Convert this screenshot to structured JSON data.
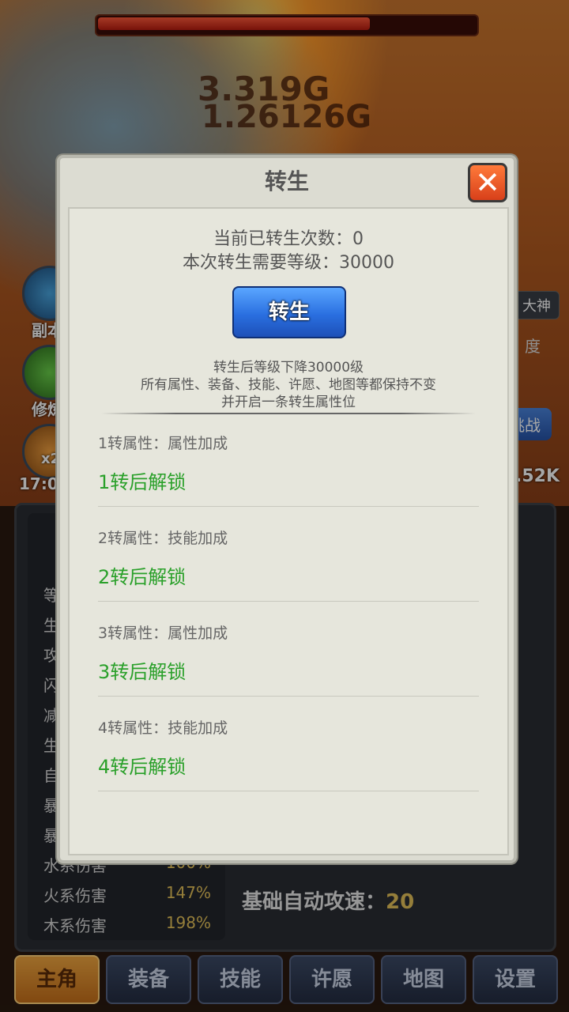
{
  "background": {
    "boss_hp_fraction": 0.72,
    "damage_numbers": [
      "3.319G",
      "1.26126G"
    ],
    "side_labels": [
      "副本",
      "修炼",
      "x2"
    ],
    "right_tag": "大神",
    "right_hint": "度",
    "challenge_label": "挑战",
    "time": "17:09",
    "power": "6.52K"
  },
  "stats": {
    "rows": [
      {
        "label": "等",
        "value": ""
      },
      {
        "label": "生",
        "value": ""
      },
      {
        "label": "攻",
        "value": ""
      },
      {
        "label": "闪",
        "value": ""
      },
      {
        "label": "减",
        "value": ""
      },
      {
        "label": "生",
        "value": ""
      },
      {
        "label": "自",
        "value": ""
      },
      {
        "label": "暴",
        "value": ""
      },
      {
        "label": "暴",
        "value": ""
      },
      {
        "label": "水系伤害",
        "value": "100%"
      },
      {
        "label": "火系伤害",
        "value": "147%"
      },
      {
        "label": "木系伤害",
        "value": "198%"
      }
    ],
    "auto_speed_label": "基础自动攻速：",
    "auto_speed_value": "20"
  },
  "tabs": [
    {
      "label": "主角",
      "active": true
    },
    {
      "label": "装备",
      "active": false
    },
    {
      "label": "技能",
      "active": false
    },
    {
      "label": "许愿",
      "active": false
    },
    {
      "label": "地图",
      "active": false
    },
    {
      "label": "设置",
      "active": false
    }
  ],
  "dialog": {
    "title": "转生",
    "close_icon": "close-x",
    "rebirth_count": "当前已转生次数：0",
    "required_level": "本次转生需要等级：30000",
    "rebirth_button": "转生",
    "notes": [
      "转生后等级下降30000级",
      "所有属性、装备、技能、许愿、地图等都保持不变",
      "并开启一条转生属性位"
    ],
    "attributes": [
      {
        "title": "1转属性：属性加成",
        "status": "1转后解锁"
      },
      {
        "title": "2转属性：技能加成",
        "status": "2转后解锁"
      },
      {
        "title": "3转属性：属性加成",
        "status": "3转后解锁"
      },
      {
        "title": "4转属性：技能加成",
        "status": "4转后解锁"
      }
    ],
    "colors": {
      "unlock_text": "#2aa02a",
      "button": "#2a6fe0",
      "close": "#e8502a"
    }
  }
}
